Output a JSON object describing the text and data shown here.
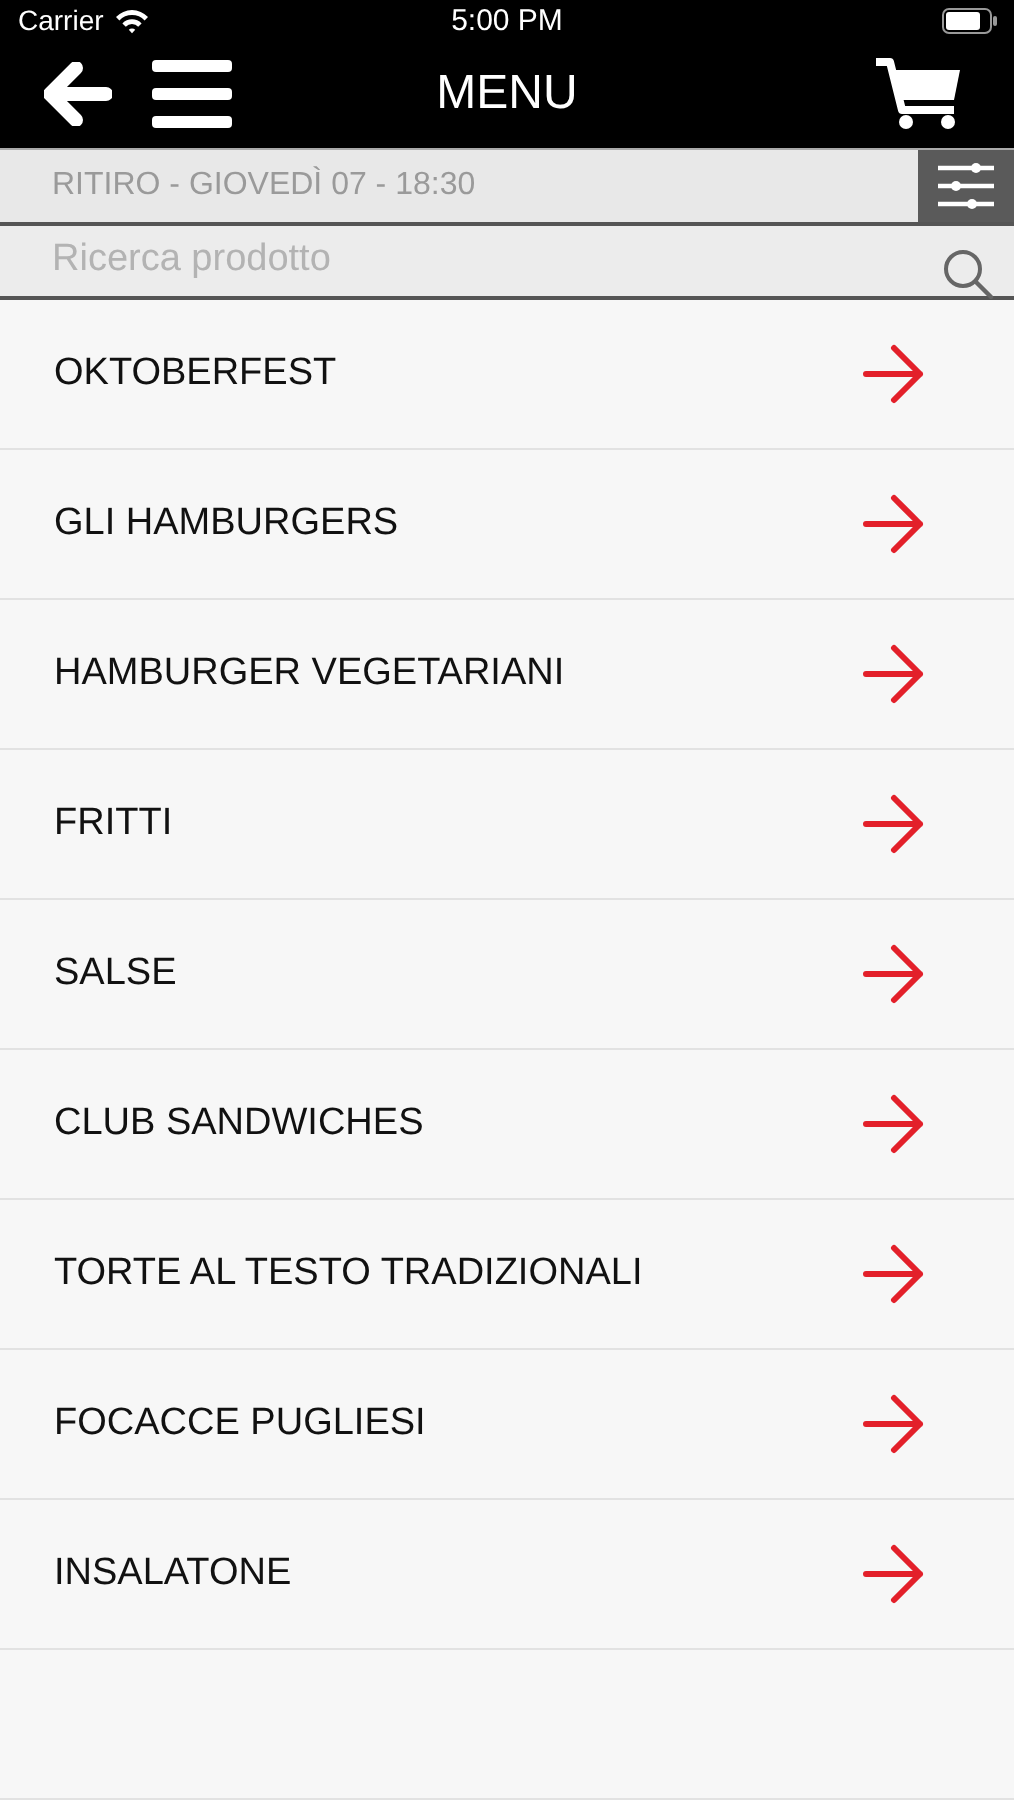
{
  "status_bar": {
    "carrier": "Carrier",
    "time": "5:00 PM"
  },
  "nav": {
    "title": "MENU"
  },
  "pickup": {
    "label": "RITIRO - GIOVEDÌ 07 - 18:30"
  },
  "search": {
    "placeholder": "Ricerca prodotto"
  },
  "categories": [
    {
      "label": "OKTOBERFEST"
    },
    {
      "label": "GLI HAMBURGERS"
    },
    {
      "label": "HAMBURGER VEGETARIANI"
    },
    {
      "label": "FRITTI"
    },
    {
      "label": "SALSE"
    },
    {
      "label": "CLUB SANDWICHES"
    },
    {
      "label": "TORTE AL TESTO TRADIZIONALI"
    },
    {
      "label": "FOCACCE PUGLIESI"
    },
    {
      "label": "INSALATONE"
    }
  ]
}
